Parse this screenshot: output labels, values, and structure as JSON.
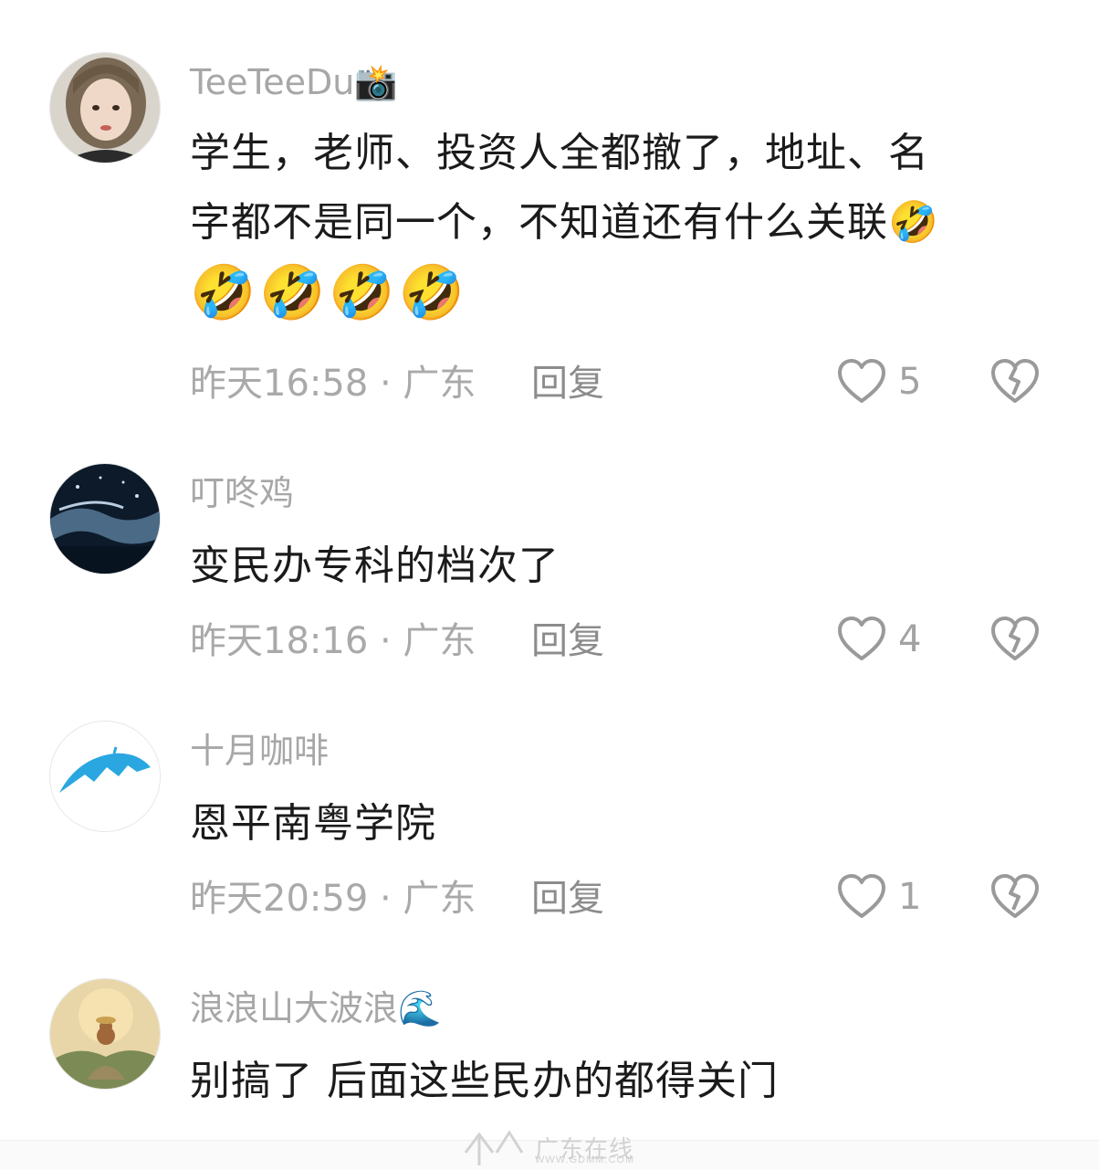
{
  "comments": [
    {
      "username": "TeeTeeDu",
      "badge": "📸",
      "text_line1": "学生，老师、投资人全都撤了，地址、名",
      "text_line2": "字都不是同一个，不知道还有什么关联🤣",
      "emojis": "🤣🤣🤣🤣",
      "meta": "昨天16:58 · 广东",
      "reply": "回复",
      "likes": "5"
    },
    {
      "username": "叮咚鸡",
      "text": "变民办专科的档次了",
      "meta": "昨天18:16 · 广东",
      "reply": "回复",
      "likes": "4"
    },
    {
      "username": "十月咖啡",
      "text": "恩平南粤学院",
      "meta": "昨天20:59 · 广东",
      "reply": "回复",
      "likes": "1"
    },
    {
      "username": "浪浪山大波浪",
      "badge": "🌊",
      "text": "别搞了 后面这些民办的都得关门"
    }
  ],
  "watermark": {
    "main": "广东在线",
    "sub": "WWW.GDMM.COM"
  },
  "colors": {
    "username": "#a7a7a7",
    "text": "#1b1b1b",
    "meta": "#a9a9a9",
    "icon": "#9a9a9a"
  }
}
